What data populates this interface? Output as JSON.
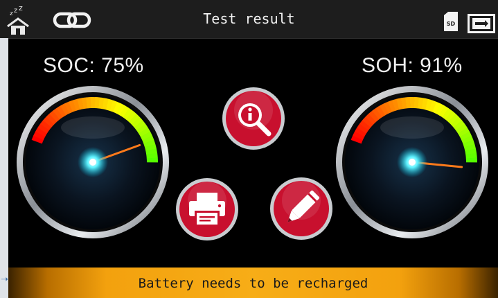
{
  "header": {
    "title": "Test result",
    "home_icon": "home-sleep-icon",
    "link_icon": "link-icon",
    "sd_icon": "sd-card-icon",
    "sd_label": "SD",
    "switch_icon": "switch-screen-icon"
  },
  "gauges": {
    "soc": {
      "label": "SOC: 75%",
      "value": 75
    },
    "soh": {
      "label": "SOH: 91%",
      "value": 91
    }
  },
  "buttons": {
    "info": "info-search-icon",
    "print": "printer-icon",
    "edit": "pencil-icon"
  },
  "status": {
    "message": "Battery needs to be recharged"
  },
  "colors": {
    "button_red": "#c8102e",
    "status_orange": "#f7ad17",
    "gauge_needle": "#ff7a1a",
    "gauge_center": "#4ef0ff"
  }
}
